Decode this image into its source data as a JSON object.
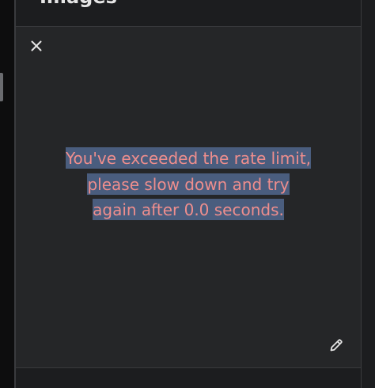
{
  "header": {
    "title": "Images"
  },
  "panel": {
    "close_icon": "close-icon",
    "edit_icon": "pencil-icon",
    "error_message": "You've exceeded the rate limit, please slow down and try again after 0.0 seconds."
  },
  "colors": {
    "background": "#1c1d1f",
    "panel": "#252628",
    "error_text": "#ef8e8d",
    "selection_highlight": "#4a5d7e"
  }
}
